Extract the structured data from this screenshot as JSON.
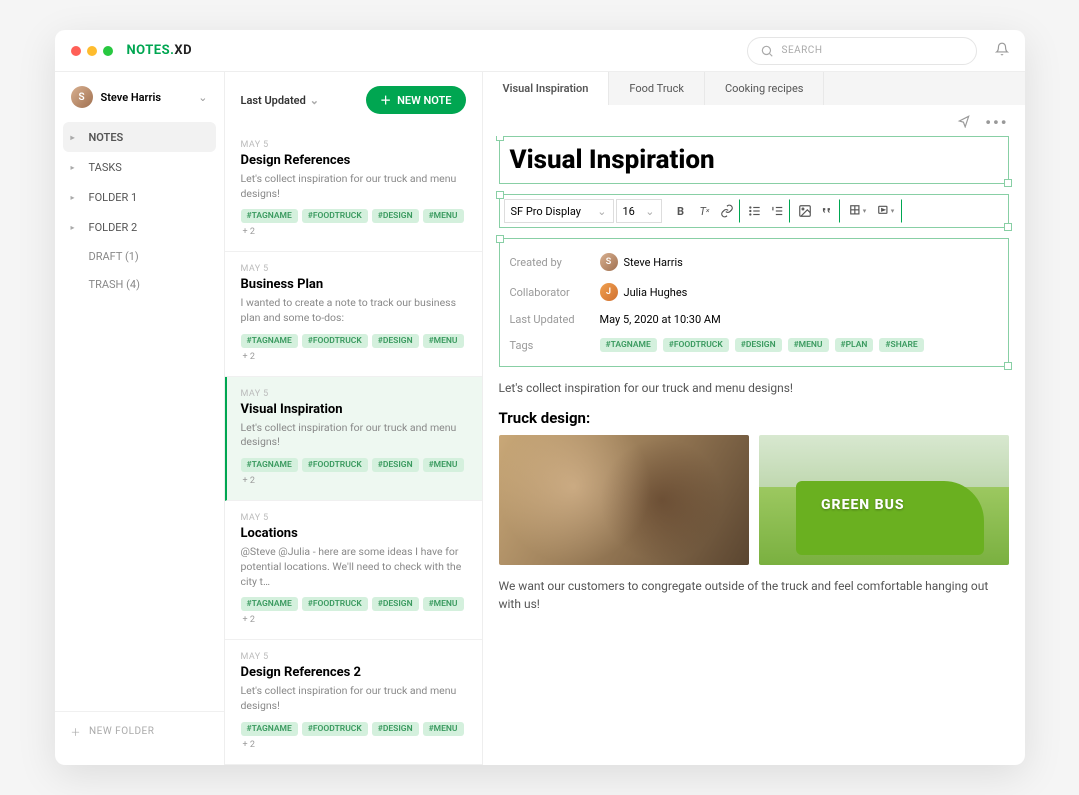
{
  "app": {
    "logo_a": "NOTES.",
    "logo_b": "XD"
  },
  "search": {
    "placeholder": "SEARCH"
  },
  "user": {
    "name": "Steve Harris",
    "initial": "S"
  },
  "nav": {
    "notes": "NOTES",
    "tasks": "TASKS",
    "folder1": "FOLDER 1",
    "folder2": "FOLDER 2",
    "draft": "DRAFT (1)",
    "trash": "TRASH (4)",
    "new_folder": "NEW FOLDER"
  },
  "list": {
    "sort": "Last Updated",
    "new_note": "NEW NOTE",
    "plus2": "+ 2",
    "common_tags": [
      "#TAGNAME",
      "#FOODTRUCK",
      "#DESIGN",
      "#MENU"
    ],
    "items": [
      {
        "date": "MAY 5",
        "title": "Design References",
        "preview": "Let's collect inspiration for our truck and menu designs!"
      },
      {
        "date": "MAY 5",
        "title": "Business Plan",
        "preview": "I wanted to create a note to track our business plan and some to-dos:"
      },
      {
        "date": "MAY 5",
        "title": "Visual Inspiration",
        "preview": "Let's collect inspiration for our truck and menu designs!"
      },
      {
        "date": "MAY 5",
        "title": "Locations",
        "preview": "@Steve @Julia - here are some ideas I have for potential locations. We'll need to check with the city t…"
      },
      {
        "date": "MAY 5",
        "title": "Design References 2",
        "preview": "Let's collect inspiration for our truck and menu designs!"
      }
    ]
  },
  "tabs": [
    {
      "label": "Visual Inspiration",
      "active": true
    },
    {
      "label": "Food Truck",
      "active": false
    },
    {
      "label": "Cooking recipes",
      "active": false
    }
  ],
  "doc": {
    "title": "Visual Inspiration",
    "toolbar": {
      "font": "SF Pro Display",
      "size": "16"
    },
    "meta": {
      "created_label": "Created by",
      "created_name": "Steve Harris",
      "collab_label": "Collaborator",
      "collab_name": "Julia Hughes",
      "updated_label": "Last Updated",
      "updated_value": "May 5, 2020 at 10:30 AM",
      "tags_label": "Tags",
      "tags": [
        "#TAGNAME",
        "#FOODTRUCK",
        "#DESIGN",
        "#MENU",
        "#PLAN",
        "#SHARE"
      ]
    },
    "intro": "Let's collect inspiration for our truck and menu designs!",
    "h2": "Truck design:",
    "bus_text": "GREEN BUS",
    "outro": "We want our customers to congregate outside of the truck and feel comfortable hanging out with us!"
  }
}
